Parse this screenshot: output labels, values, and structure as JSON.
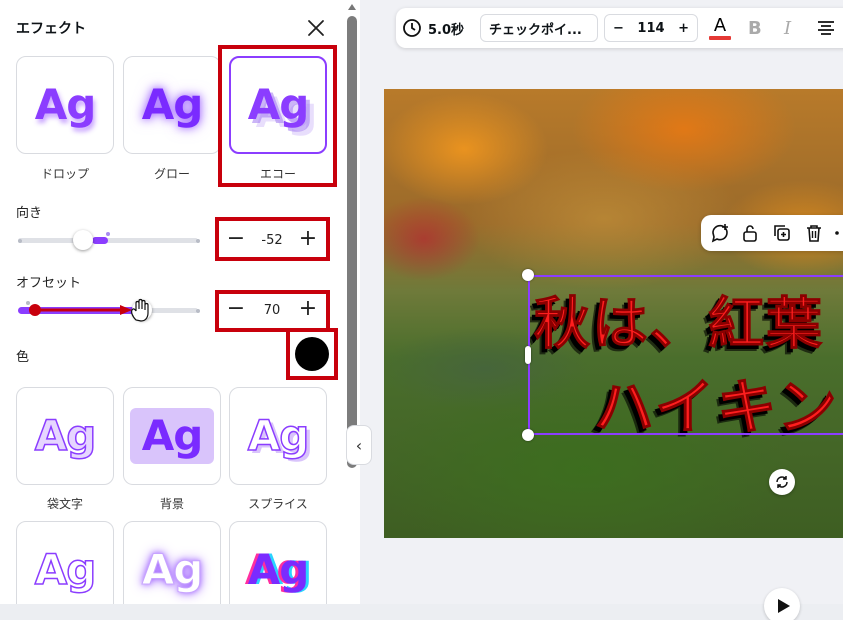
{
  "panel": {
    "title": "エフェクト",
    "effects_top": [
      {
        "label": "ドロップ",
        "sample": "Ag"
      },
      {
        "label": "グロー",
        "sample": "Ag"
      },
      {
        "label": "エコー",
        "sample": "Ag",
        "selected": true
      }
    ],
    "direction": {
      "label": "向き",
      "value": "-52"
    },
    "offset": {
      "label": "オフセット",
      "value": "70"
    },
    "color": {
      "label": "色",
      "swatch": "#000000"
    },
    "effects_bottom": [
      {
        "label": "袋文字",
        "sample": "Ag"
      },
      {
        "label": "背景",
        "sample": "Ag"
      },
      {
        "label": "スプライス",
        "sample": "Ag"
      },
      {
        "label": "",
        "sample": "Ag"
      },
      {
        "label": "",
        "sample": "Ag"
      },
      {
        "label": "",
        "sample": "Ag"
      }
    ],
    "stepper_minus": "−",
    "stepper_plus": "+"
  },
  "toolbar": {
    "duration": "5.0秒",
    "font": "チェックポイ...",
    "size_minus": "−",
    "font_size": "114",
    "size_plus": "+",
    "color_letter": "A",
    "bold": "B",
    "italic": "I"
  },
  "canvas": {
    "line1": "秋は、紅葉",
    "line2": "ハイキン"
  },
  "colors": {
    "accent": "#8b3dff",
    "highlight_box": "#c8000c",
    "text_red": "#ff1e1e"
  }
}
